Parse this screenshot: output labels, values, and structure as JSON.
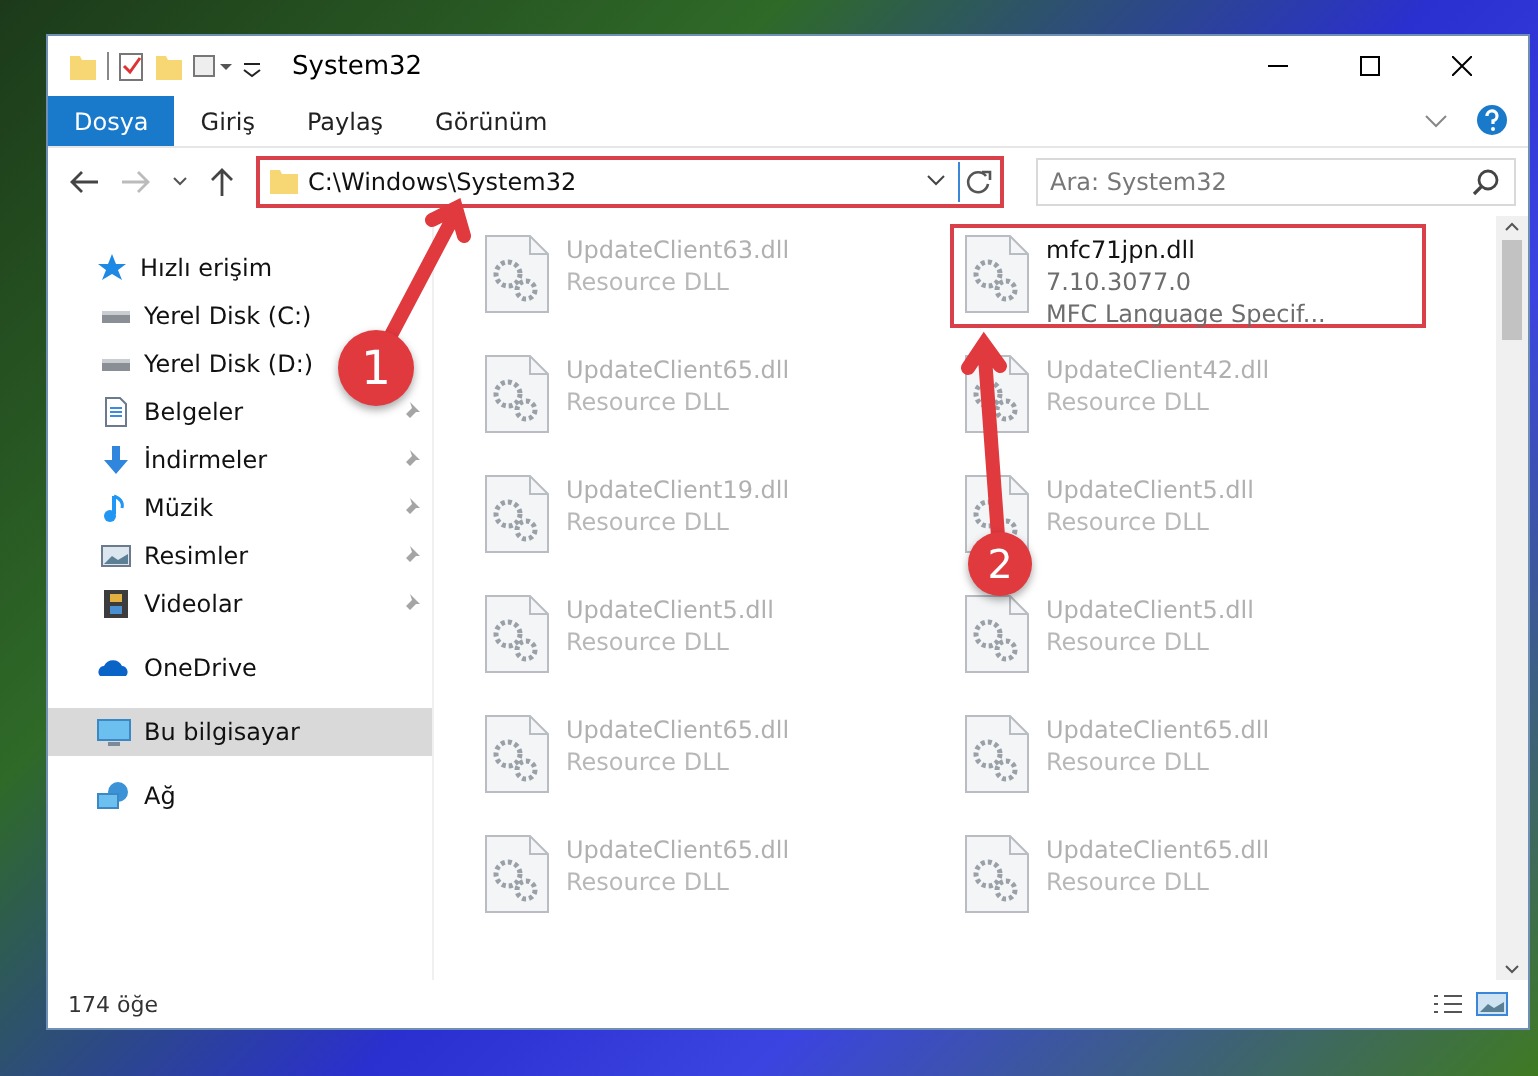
{
  "window": {
    "title": "System32"
  },
  "ribbon_tabs": [
    {
      "label": "Dosya",
      "selected": true
    },
    {
      "label": "Giriş",
      "selected": false
    },
    {
      "label": "Paylaş",
      "selected": false
    },
    {
      "label": "Görünüm",
      "selected": false
    }
  ],
  "address_bar": {
    "path": "C:\\Windows\\System32",
    "highlighted": true
  },
  "search": {
    "placeholder": "Ara: System32"
  },
  "sidebar": {
    "items": [
      {
        "label": "Hızlı erişim",
        "kind": "star",
        "pinned": false,
        "selected": false,
        "group": true
      },
      {
        "label": "Yerel Disk (C:)",
        "kind": "drive",
        "pinned": false,
        "selected": false,
        "group": false
      },
      {
        "label": "Yerel Disk (D:)",
        "kind": "drive",
        "pinned": false,
        "selected": false,
        "group": false
      },
      {
        "label": "Belgeler",
        "kind": "document",
        "pinned": true,
        "selected": false,
        "group": false
      },
      {
        "label": "İndirmeler",
        "kind": "download",
        "pinned": true,
        "selected": false,
        "group": false
      },
      {
        "label": "Müzik",
        "kind": "music",
        "pinned": true,
        "selected": false,
        "group": false
      },
      {
        "label": "Resimler",
        "kind": "picture",
        "pinned": true,
        "selected": false,
        "group": false
      },
      {
        "label": "Videolar",
        "kind": "video",
        "pinned": true,
        "selected": false,
        "group": false
      },
      {
        "label": "OneDrive",
        "kind": "cloud",
        "pinned": false,
        "selected": false,
        "group": true
      },
      {
        "label": "Bu bilgisayar",
        "kind": "computer",
        "pinned": false,
        "selected": true,
        "group": true
      },
      {
        "label": "Ağ",
        "kind": "network",
        "pinned": false,
        "selected": false,
        "group": true
      }
    ]
  },
  "files": [
    {
      "name": "UpdateClient63.dll",
      "line_2": "Resource DLL",
      "highlighted": false
    },
    {
      "name": "mfc71jpn.dll",
      "line_2": "7.10.3077.0",
      "line_3": "MFC Language Specif...",
      "highlighted": true
    },
    {
      "name": "UpdateClient65.dll",
      "line_2": "Resource DLL",
      "highlighted": false
    },
    {
      "name": "UpdateClient42.dll",
      "line_2": "Resource DLL",
      "highlighted": false
    },
    {
      "name": "UpdateClient19.dll",
      "line_2": "Resource DLL",
      "highlighted": false
    },
    {
      "name": "UpdateClient5.dll",
      "line_2": "Resource DLL",
      "highlighted": false
    },
    {
      "name": "UpdateClient5.dll",
      "line_2": "Resource DLL",
      "highlighted": false
    },
    {
      "name": "UpdateClient5.dll",
      "line_2": "Resource DLL",
      "highlighted": false
    },
    {
      "name": "UpdateClient65.dll",
      "line_2": "Resource DLL",
      "highlighted": false
    },
    {
      "name": "UpdateClient65.dll",
      "line_2": "Resource DLL",
      "highlighted": false
    },
    {
      "name": "UpdateClient65.dll",
      "line_2": "Resource DLL",
      "highlighted": false
    },
    {
      "name": "UpdateClient65.dll",
      "line_2": "Resource DLL",
      "highlighted": false
    }
  ],
  "status_bar": {
    "count": "174 öğe"
  },
  "annotations": [
    {
      "label": "1"
    },
    {
      "label": "2"
    }
  ]
}
